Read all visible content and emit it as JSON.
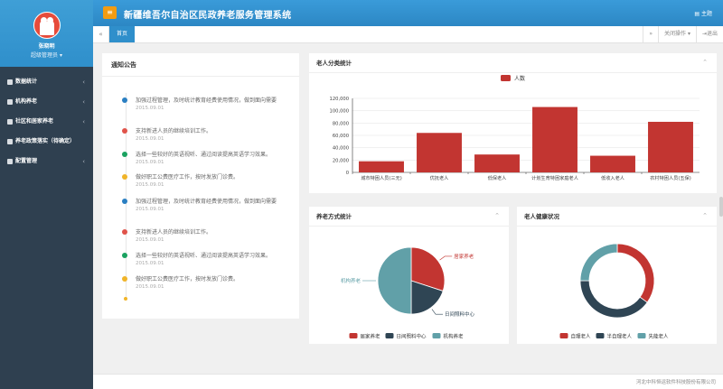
{
  "app": {
    "title": "新疆维吾尔自治区民政养老服务管理系统",
    "theme_label": "主题",
    "menu_icon": "menu-icon"
  },
  "user": {
    "name": "张晓明",
    "role": "超级管理员 ▾"
  },
  "sidebar": {
    "items": [
      {
        "label": "数据统计",
        "icon": "chart-icon"
      },
      {
        "label": "机构养老",
        "icon": "home-icon"
      },
      {
        "label": "社区和居家养老",
        "icon": "flag-icon"
      },
      {
        "label": "养老政策落实（待确定）",
        "icon": "user-icon"
      },
      {
        "label": "配置管理",
        "icon": "gear-icon"
      }
    ]
  },
  "tabs": {
    "back": "«",
    "home": "首页",
    "forward": "»",
    "close_ops": "关闭操作 ▾",
    "logout": "退出"
  },
  "notice": {
    "title": "通知公告",
    "items": [
      {
        "text": "加强过程管理，及时统计教育经费使用情况，做到面向需要",
        "date": "2015.09.01",
        "color": "#2a7fc2"
      },
      {
        "text": "支持新进人员的继续培训工作。",
        "date": "2015.09.01",
        "color": "#e0534a"
      },
      {
        "text": "选择一些较好的英语视听、通过阅读提高英语学习效果。",
        "date": "2015.09.01",
        "color": "#1aa260"
      },
      {
        "text": "做好职工公费医疗工作，按时发放门诊费。",
        "date": "2015.09.01",
        "color": "#f0b429"
      },
      {
        "text": "加强过程管理，及时统计教育经费使用情况，做到面向需要",
        "date": "2015.09.01",
        "color": "#2a7fc2"
      },
      {
        "text": "支持新进人员的继续培训工作。",
        "date": "2015.09.01",
        "color": "#e0534a"
      },
      {
        "text": "选择一些较好的英语视听、通过阅读提高英语学习效果。",
        "date": "2015.09.01",
        "color": "#1aa260"
      },
      {
        "text": "做好职工公费医疗工作，按时发放门诊费。",
        "date": "2015.09.01",
        "color": "#f0b429"
      }
    ]
  },
  "panels": {
    "elder_title": "老人分类统计",
    "care_title": "养老方式统计",
    "health_title": "老人健康状况"
  },
  "footer": {
    "text": "河北中科恒运软件科技股份有限公司"
  },
  "chart_data": [
    {
      "type": "bar",
      "categories": [
        "城市特困人员(三无)",
        "优抚老人",
        "低保老人",
        "计划生育特困家庭老人",
        "低收入老人",
        "农村特困人员(五保)"
      ],
      "series": [
        {
          "name": "人数",
          "values": [
            18000,
            64000,
            29000,
            106000,
            27000,
            82000
          ],
          "color": "#c23531"
        }
      ],
      "ylim": [
        0,
        120000
      ],
      "yticks": [
        "0",
        "20,000",
        "40,000",
        "60,000",
        "80,000",
        "100,000",
        "120,000"
      ],
      "legend": "top-center",
      "grid": true
    },
    {
      "type": "pie",
      "labels": [
        "居家养老",
        "日间照料中心",
        "机构养老"
      ],
      "values": [
        30,
        20,
        50
      ],
      "colors": [
        "#c23531",
        "#2f4554",
        "#61a0a8"
      ],
      "legend": "bottom-center"
    },
    {
      "type": "pie",
      "labels": [
        "自理老人",
        "半自理老人",
        "失能老人"
      ],
      "values": [
        35,
        40,
        25
      ],
      "colors": [
        "#c23531",
        "#2f4554",
        "#61a0a8"
      ],
      "donut": true,
      "legend": "bottom-center"
    }
  ]
}
